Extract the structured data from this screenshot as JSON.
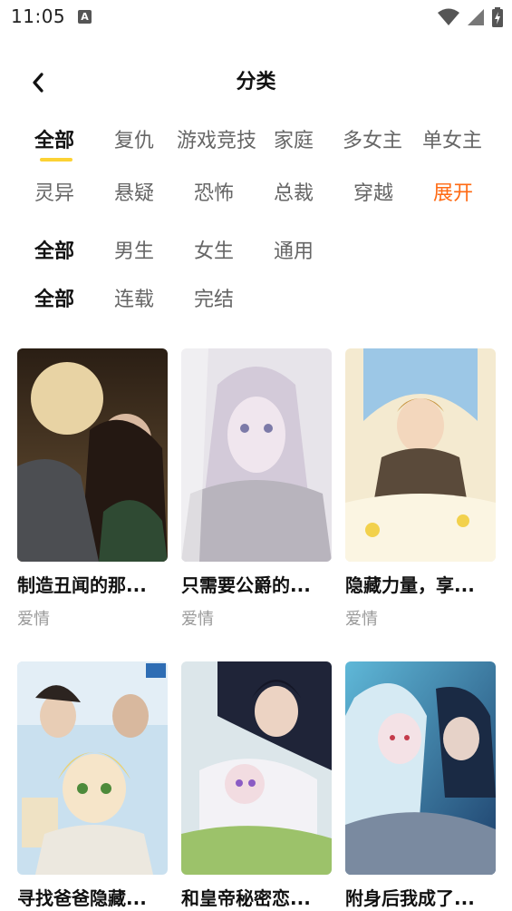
{
  "status_bar": {
    "time": "11:05",
    "badge": "A"
  },
  "header": {
    "title": "分类",
    "back_icon": "chevron-left-icon"
  },
  "filters": {
    "genre_row1": [
      "全部",
      "复仇",
      "游戏竞技",
      "家庭",
      "多女主",
      "单女主"
    ],
    "genre_row2": [
      "灵异",
      "悬疑",
      "恐怖",
      "总裁",
      "穿越",
      "展开"
    ],
    "audience": [
      "全部",
      "男生",
      "女生",
      "通用"
    ],
    "status": [
      "全部",
      "连载",
      "完结"
    ],
    "active_color": "#fcd234",
    "expand_color": "#ff6a13"
  },
  "comics": [
    {
      "title": "制造丑闻的那...",
      "genre": "爱情"
    },
    {
      "title": "只需要公爵的...",
      "genre": "爱情"
    },
    {
      "title": "隐藏力量，享...",
      "genre": "爱情"
    },
    {
      "title": "寻找爸爸隐藏...",
      "genre": ""
    },
    {
      "title": "和皇帝秘密恋...",
      "genre": ""
    },
    {
      "title": "附身后我成了...",
      "genre": ""
    }
  ]
}
